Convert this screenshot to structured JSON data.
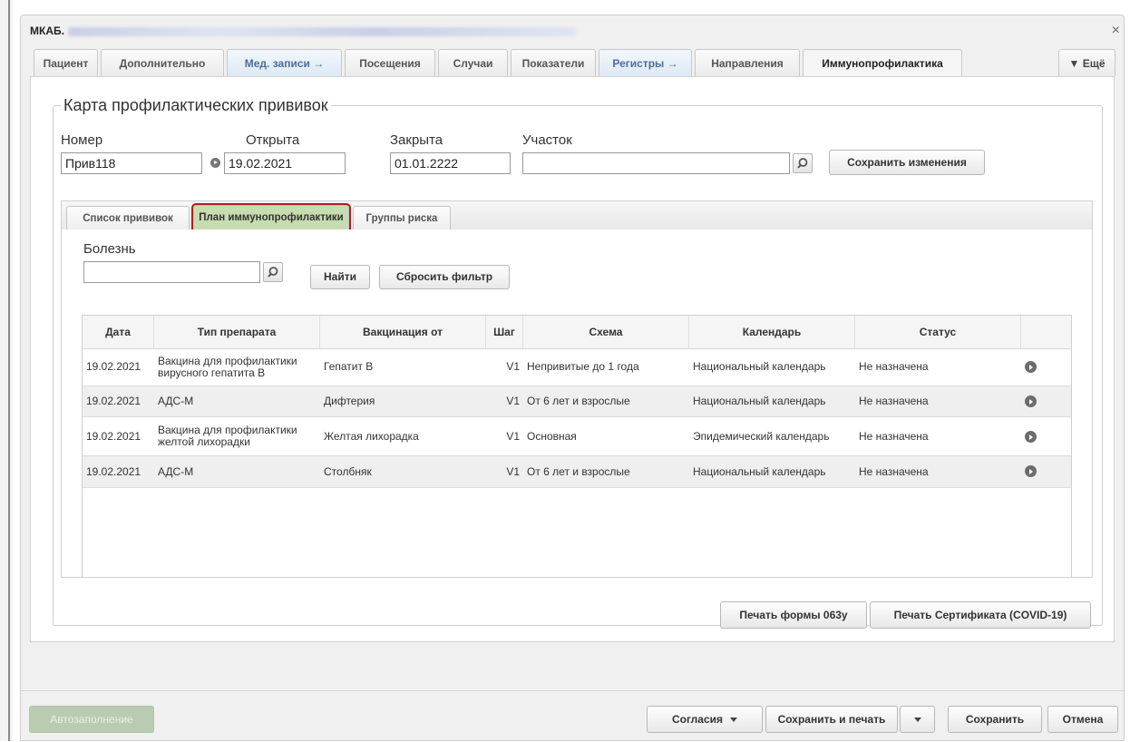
{
  "window": {
    "title": "МКАБ.",
    "close_glyph": "×"
  },
  "tabs": [
    {
      "label": "Пациент"
    },
    {
      "label": "Дополнительно"
    },
    {
      "label": "Мед. записи →"
    },
    {
      "label": "Посещения"
    },
    {
      "label": "Случаи"
    },
    {
      "label": "Показатели"
    },
    {
      "label": "Регистры →"
    },
    {
      "label": "Направления"
    },
    {
      "label": "Иммунопрофилактика"
    },
    {
      "label": "▼ Ещё"
    }
  ],
  "card": {
    "legend": "Карта профилактических прививок",
    "number_label": "Номер",
    "number_value": "Прив118",
    "opened_label": "Открыта",
    "opened_value": "19.02.2021",
    "closed_label": "Закрыта",
    "closed_value": "01.01.2222",
    "area_label": "Участок",
    "area_value": "",
    "save_changes": "Сохранить изменения"
  },
  "subtabs": [
    {
      "label": "Список прививок"
    },
    {
      "label": "План иммунопрофилактики"
    },
    {
      "label": "Группы риска"
    }
  ],
  "filter": {
    "disease_label": "Болезнь",
    "disease_value": "",
    "find": "Найти",
    "reset": "Сбросить фильтр"
  },
  "table": {
    "columns": [
      "Дата",
      "Тип препарата",
      "Вакцинация от",
      "Шаг",
      "Схема",
      "Календарь",
      "Статус"
    ],
    "rows": [
      {
        "date": "19.02.2021",
        "drug": "Вакцина для профилактики вирусного гепатита В",
        "against": "Гепатит В",
        "step": "V1",
        "scheme": "Непривитые до 1 года",
        "calendar": "Национальный календарь",
        "status": "Не назначена"
      },
      {
        "date": "19.02.2021",
        "drug": "АДС-М",
        "against": "Дифтерия",
        "step": "V1",
        "scheme": "От 6 лет и взрослые",
        "calendar": "Национальный календарь",
        "status": "Не назначена"
      },
      {
        "date": "19.02.2021",
        "drug": "Вакцина для профилактики желтой лихорадки",
        "against": "Желтая лихорадка",
        "step": "V1",
        "scheme": "Основная",
        "calendar": "Эпидемический календарь",
        "status": "Не назначена"
      },
      {
        "date": "19.02.2021",
        "drug": "АДС-М",
        "against": "Столбняк",
        "step": "V1",
        "scheme": "От 6 лет и взрослые",
        "calendar": "Национальный календарь",
        "status": "Не назначена"
      }
    ]
  },
  "print": {
    "form063": "Печать формы 063у",
    "certificate": "Печать Сертификата (COVID-19)"
  },
  "footer": {
    "autofill": "Автозаполнение",
    "consents": "Согласия",
    "save_print": "Сохранить и печать",
    "save": "Сохранить",
    "cancel": "Отмена"
  },
  "colors": {
    "active_subtab": "#c6dcb1",
    "highlight_outline": "#b31c1c",
    "blue_tab_text": "#4a6f99",
    "disabled_button": "#b9ccb0"
  },
  "icons": [
    "search-icon",
    "arrow-circle-icon",
    "close-icon",
    "caret-down-icon"
  ]
}
